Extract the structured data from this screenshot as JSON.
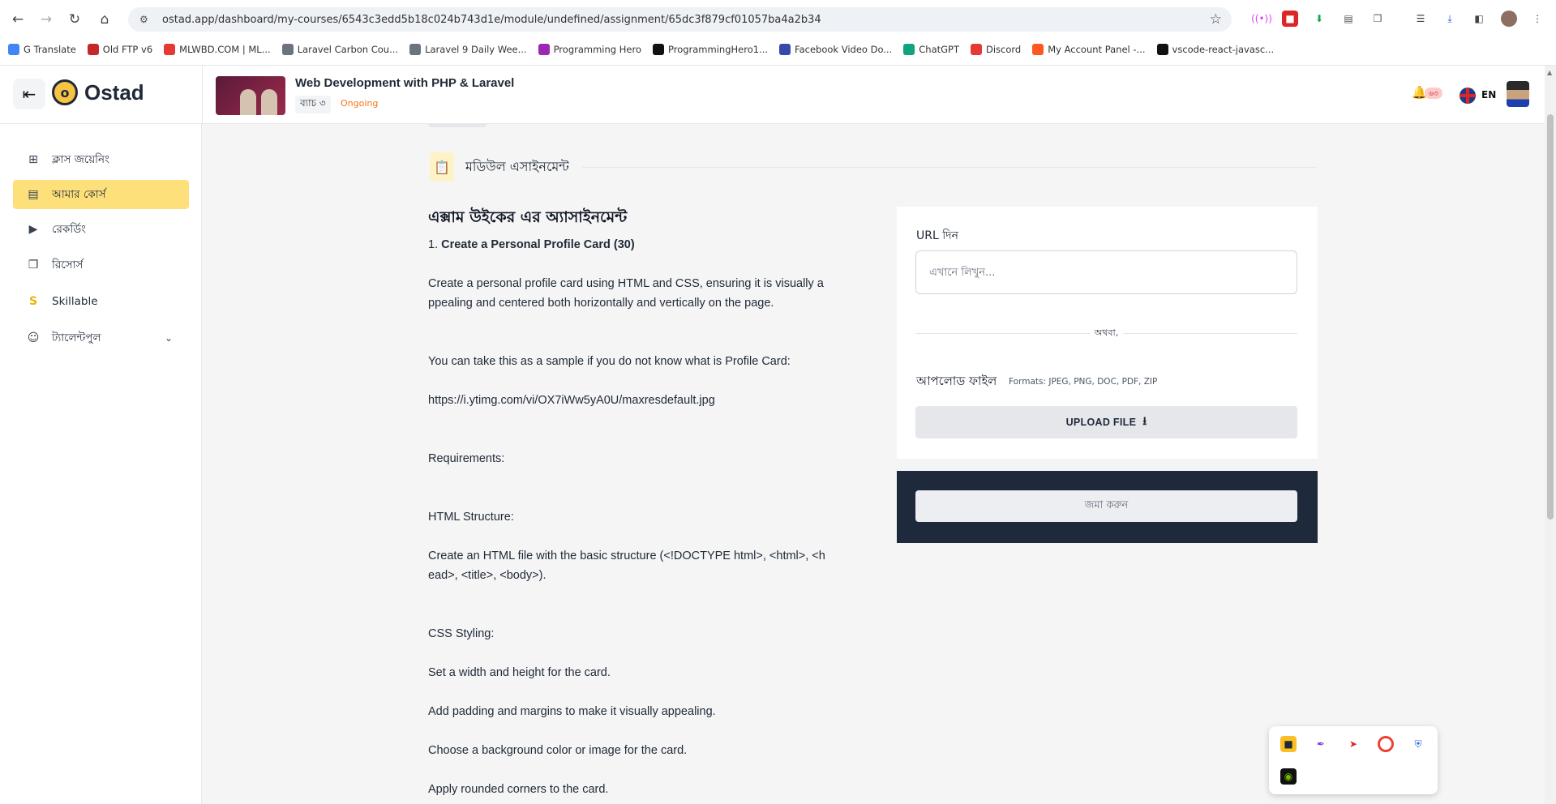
{
  "browser": {
    "url": "ostad.app/dashboard/my-courses/6543c3edd5b18c024b743d1e/module/undefined/assignment/65dc3f879cf01057ba4a2b34",
    "bookmarks": [
      {
        "label": "G Translate",
        "color": "#4285f4"
      },
      {
        "label": "Old FTP v6",
        "color": "#c62828"
      },
      {
        "label": "MLWBD.COM | ML...",
        "color": "#e53935"
      },
      {
        "label": "Laravel Carbon Cou...",
        "color": "#6b7280"
      },
      {
        "label": "Laravel 9 Daily Wee...",
        "color": "#6b7280"
      },
      {
        "label": "Programming Hero",
        "color": "#9c27b0"
      },
      {
        "label": "ProgrammingHero1...",
        "color": "#111111"
      },
      {
        "label": "Facebook Video Do...",
        "color": "#3949ab"
      },
      {
        "label": "ChatGPT",
        "color": "#10a37f"
      },
      {
        "label": "Discord",
        "color": "#e53935"
      },
      {
        "label": "My Account Panel -...",
        "color": "#ff5722"
      },
      {
        "label": "vscode-react-javasc...",
        "color": "#111111"
      }
    ]
  },
  "header": {
    "logo_text": "Ostad",
    "course_title": "Web Development with PHP & Laravel",
    "batch": "ব্যাচ ৩",
    "status": "Ongoing",
    "notification_count": "৬৩",
    "language": "EN"
  },
  "sidebar": {
    "items": [
      {
        "label": "ক্লাস জয়েনিং",
        "icon": "plus-square-icon"
      },
      {
        "label": "আমার কোর্স",
        "icon": "book-icon",
        "active": true
      },
      {
        "label": "রেকর্ডিং",
        "icon": "play-square-icon"
      },
      {
        "label": "রিসোর্স",
        "icon": "copy-icon"
      },
      {
        "label": "Skillable",
        "icon": "skillable-logo-icon"
      },
      {
        "label": "ট্যালেন্টপুল",
        "icon": "user-search-icon"
      }
    ]
  },
  "main": {
    "section_title": "মডিউল এসাইনমেন্ট",
    "assignment_title": "এক্সাম উইকের এর অ্যাসাইনমেন্ট",
    "question_number": "1.",
    "question_title": "Create a Personal Profile Card (30)",
    "lines": [
      "Create a personal profile card using HTML and CSS, ensuring it is visually a",
      "ppealing and centered both horizontally and vertically on the page.",
      "You can take this as a sample if you do not know what is Profile Card:",
      "https://i.ytimg.com/vi/OX7iWw5yA0U/maxresdefault.jpg",
      "Requirements:",
      "HTML Structure:",
      "Create an HTML file with the basic structure (<!DOCTYPE html>, <html>, <h",
      "ead>, <title>, <body>).",
      "CSS Styling:",
      "Set a width and height for the card.",
      "Add padding and margins to make it visually appealing.",
      "Choose a background color or image for the card.",
      "Apply rounded corners to the card."
    ]
  },
  "submit_panel": {
    "url_label": "URL দিন",
    "url_placeholder": "এখানে লিখুন...",
    "url_value": "",
    "or_text": "অথবা,",
    "upload_label": "আপলোড ফাইল",
    "formats": "Formats: JPEG, PNG, DOC, PDF, ZIP",
    "upload_button": "UPLOAD FILE",
    "submit_button": "জমা করুন"
  },
  "colors": {
    "accent": "#fde07a",
    "footer": "#1e293b",
    "status": "#f97316"
  }
}
